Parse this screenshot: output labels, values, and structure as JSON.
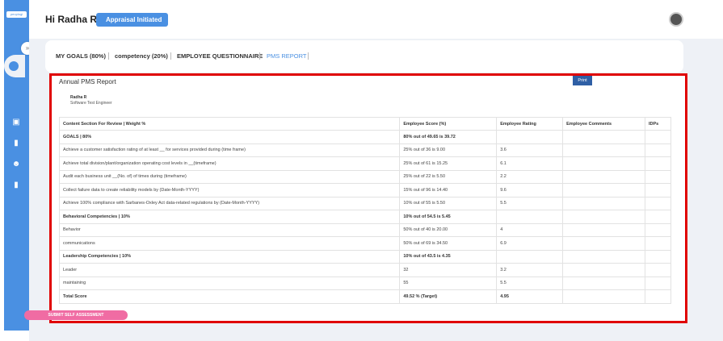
{
  "sidebar": {
    "logo_text": "peoplogi",
    "items": [
      "home-icon",
      "book-icon",
      "team-icon",
      "doc-icon"
    ]
  },
  "header": {
    "greeting": "Hi Radha R",
    "status_badge": "Appraisal Initiated"
  },
  "tabs": [
    {
      "label": "MY GOALS (80%)"
    },
    {
      "label": "competency (20%)"
    },
    {
      "label": "EMPLOYEE QUESTIONNAIRE"
    },
    {
      "label": "PMS REPORT"
    }
  ],
  "report": {
    "title": "Annual PMS Report",
    "print_label": "Print",
    "employee_name": "Radha R",
    "employee_role": "Software Test Engineer",
    "columns": [
      "Content Section For Review | Weight %",
      "Employee Score (%)",
      "Employee Rating",
      "Employee Comments",
      "IDPs"
    ],
    "rows": [
      {
        "type": "section",
        "cells": [
          "GOALS | 80%",
          "80% out of 49.65 is 39.72",
          "",
          "",
          ""
        ]
      },
      {
        "type": "row",
        "cells": [
          "Achieve a customer satisfaction rating of at least __ for services provided during (time frame)",
          "25% out of 36 is 9.00",
          "3.6",
          "",
          ""
        ]
      },
      {
        "type": "row",
        "cells": [
          "Achieve total division/plant/organization operating cost levels in __(timeframe)",
          "25% out of 61 is 15.25",
          "6.1",
          "",
          ""
        ]
      },
      {
        "type": "row",
        "cells": [
          "Audit each business unit __(No. of) of times during (timeframe)",
          "25% out of 22 is 5.50",
          "2.2",
          "",
          ""
        ]
      },
      {
        "type": "row",
        "cells": [
          "Collect failure data to create reliability models by (Date-Month-YYYY)",
          "15% out of 96 is 14.40",
          "9.6",
          "",
          ""
        ]
      },
      {
        "type": "row",
        "cells": [
          "Achieve 100% compliance with Sarbanes-Oxley Act data-related regulations by (Date-Month-YYYY)",
          "10% out of 55 is 5.50",
          "5.5",
          "",
          ""
        ]
      },
      {
        "type": "section",
        "cells": [
          "Behavioral Competencies | 10%",
          "10% out of 54.5 is 5.45",
          "",
          "",
          ""
        ]
      },
      {
        "type": "row",
        "cells": [
          "Behavior",
          "50% out of 40 is 20.00",
          "4",
          "",
          ""
        ]
      },
      {
        "type": "row",
        "cells": [
          "communications",
          "50% out of 69 is 34.50",
          "6.9",
          "",
          ""
        ]
      },
      {
        "type": "section",
        "cells": [
          "Leadership Competencies | 10%",
          "10% out of 43.5 is 4.35",
          "",
          "",
          ""
        ]
      },
      {
        "type": "row",
        "cells": [
          "Leader",
          "32",
          "3.2",
          "",
          ""
        ]
      },
      {
        "type": "row",
        "cells": [
          "maintaining",
          "55",
          "5.5",
          "",
          ""
        ]
      },
      {
        "type": "section",
        "cells": [
          "Total Score",
          "49.52 % (Target)",
          "4.95",
          "",
          ""
        ]
      }
    ],
    "submit_label": "SUBMIT SELF ASSESSMENT"
  },
  "colors": {
    "accent": "#4a90e2",
    "highlight_border": "#e00000",
    "submit": "#f06ca3",
    "print": "#2f5fa5"
  }
}
